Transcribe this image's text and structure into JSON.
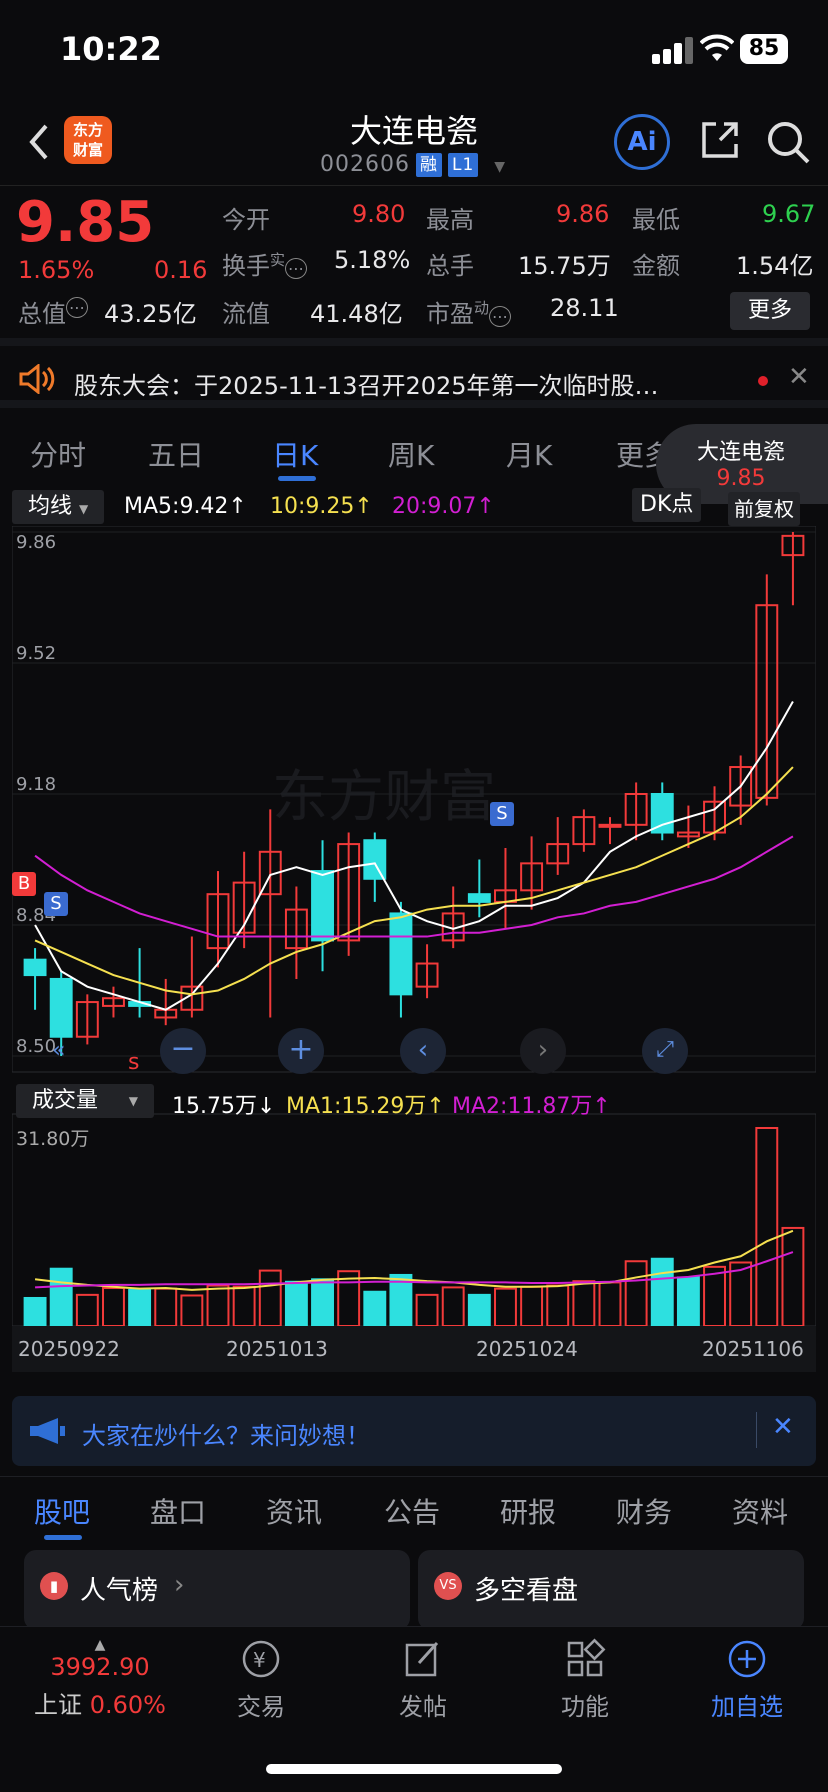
{
  "status_bar": {
    "time": "10:22",
    "battery": "85"
  },
  "header": {
    "logo_text": "东方财富",
    "title": "大连电瓷",
    "code": "002606",
    "tag1": "融",
    "tag2": "L1"
  },
  "quote": {
    "price": "9.85",
    "change_pct": "1.65%",
    "change": "0.16",
    "open_label": "今开",
    "open": "9.80",
    "high_label": "最高",
    "high": "9.86",
    "low_label": "最低",
    "low": "9.67",
    "turnover_label": "换手",
    "turnover_sup": "实",
    "turnover": "5.18%",
    "volume_label": "总手",
    "volume": "15.75万",
    "amount_label": "金额",
    "amount": "1.54亿",
    "mktcap_label": "总值",
    "mktcap": "43.25亿",
    "float_label": "流值",
    "float": "41.48亿",
    "pe_label": "市盈",
    "pe_sup": "动",
    "pe": "28.11",
    "more": "更多"
  },
  "notice": {
    "text": "股东大会：于2025-11-13召开2025年第一次临时股…"
  },
  "tabs": [
    "分时",
    "五日",
    "日K",
    "周K",
    "月K",
    "更多"
  ],
  "chip": {
    "name": "大连电瓷",
    "price": "9.85"
  },
  "kline": {
    "ma_dropdown": "均线",
    "ma5": "MA5:9.42↑",
    "ma10": "10:9.25↑",
    "ma20": "20:9.07↑",
    "dk": "DK点",
    "adj": "前复权",
    "y_labels": [
      "9.86",
      "9.52",
      "9.18",
      "8.84",
      "8.50"
    ],
    "marker_b": "B",
    "marker_s": "S",
    "small_s": "s"
  },
  "volume": {
    "dropdown": "成交量",
    "vol": "15.75万↓",
    "ma1": "MA1:15.29万↑",
    "ma2": "MA2:11.87万↑",
    "max_label": "31.80万",
    "x_labels": [
      "20250922",
      "20251013",
      "20251024",
      "20251106"
    ]
  },
  "banner": {
    "text": "大家在炒什么？来问妙想！"
  },
  "bottom_tabs": [
    "股吧",
    "盘口",
    "资讯",
    "公告",
    "研报",
    "财务",
    "资料"
  ],
  "cards": {
    "left": "人气榜",
    "right": "多空看盘"
  },
  "footer": {
    "index_value": "3992.90",
    "index_name": "上证",
    "index_change": "0.60%",
    "items": [
      "交易",
      "发帖",
      "功能",
      "加自选"
    ]
  },
  "colors": {
    "up": "#f23a3a",
    "down": "#2de0e0",
    "ma5": "#ffffff",
    "ma10": "#f5e050",
    "ma20": "#d21fd2",
    "accent": "#2f6fd6"
  },
  "chart_data": {
    "type": "candlestick",
    "ylim": [
      8.5,
      9.86
    ],
    "candles": [
      {
        "o": 8.75,
        "c": 8.71,
        "h": 8.78,
        "l": 8.62
      },
      {
        "o": 8.7,
        "c": 8.55,
        "h": 8.72,
        "l": 8.5
      },
      {
        "o": 8.55,
        "c": 8.64,
        "h": 8.66,
        "l": 8.53
      },
      {
        "o": 8.63,
        "c": 8.65,
        "h": 8.68,
        "l": 8.6
      },
      {
        "o": 8.64,
        "c": 8.63,
        "h": 8.78,
        "l": 8.6
      },
      {
        "o": 8.6,
        "c": 8.62,
        "h": 8.7,
        "l": 8.58
      },
      {
        "o": 8.62,
        "c": 8.68,
        "h": 8.81,
        "l": 8.6
      },
      {
        "o": 8.78,
        "c": 8.92,
        "h": 8.98,
        "l": 8.73
      },
      {
        "o": 8.82,
        "c": 8.95,
        "h": 9.03,
        "l": 8.78
      },
      {
        "o": 8.92,
        "c": 9.03,
        "h": 9.14,
        "l": 8.6
      },
      {
        "o": 8.78,
        "c": 8.88,
        "h": 8.94,
        "l": 8.7
      },
      {
        "o": 8.98,
        "c": 8.8,
        "h": 9.06,
        "l": 8.72
      },
      {
        "o": 8.8,
        "c": 9.05,
        "h": 9.08,
        "l": 8.76
      },
      {
        "o": 9.06,
        "c": 8.96,
        "h": 9.08,
        "l": 8.9
      },
      {
        "o": 8.87,
        "c": 8.66,
        "h": 8.9,
        "l": 8.6
      },
      {
        "o": 8.68,
        "c": 8.74,
        "h": 8.79,
        "l": 8.65
      },
      {
        "o": 8.8,
        "c": 8.87,
        "h": 8.94,
        "l": 8.78
      },
      {
        "o": 8.92,
        "c": 8.9,
        "h": 9.01,
        "l": 8.86
      },
      {
        "o": 8.9,
        "c": 8.93,
        "h": 9.04,
        "l": 8.83
      },
      {
        "o": 8.93,
        "c": 9.0,
        "h": 9.07,
        "l": 8.88
      },
      {
        "o": 9.0,
        "c": 9.05,
        "h": 9.12,
        "l": 8.97
      },
      {
        "o": 9.05,
        "c": 9.12,
        "h": 9.14,
        "l": 9.03
      },
      {
        "o": 9.1,
        "c": 9.1,
        "h": 9.12,
        "l": 9.05
      },
      {
        "o": 9.1,
        "c": 9.18,
        "h": 9.21,
        "l": 9.06
      },
      {
        "o": 9.18,
        "c": 9.08,
        "h": 9.21,
        "l": 9.06
      },
      {
        "o": 9.07,
        "c": 9.08,
        "h": 9.15,
        "l": 9.04
      },
      {
        "o": 9.08,
        "c": 9.16,
        "h": 9.2,
        "l": 9.06
      },
      {
        "o": 9.15,
        "c": 9.25,
        "h": 9.28,
        "l": 9.1
      },
      {
        "o": 9.17,
        "c": 9.67,
        "h": 9.75,
        "l": 9.15
      },
      {
        "o": 9.8,
        "c": 9.85,
        "h": 9.86,
        "l": 9.67
      }
    ],
    "ma5": [
      8.84,
      8.72,
      8.68,
      8.66,
      8.64,
      8.62,
      8.66,
      8.74,
      8.84,
      8.97,
      8.99,
      8.97,
      8.99,
      9.0,
      8.88,
      8.85,
      8.83,
      8.85,
      8.89,
      8.89,
      8.91,
      8.95,
      9.03,
      9.07,
      9.1,
      9.12,
      9.14,
      9.2,
      9.3,
      9.42
    ],
    "ma10": [
      8.8,
      8.77,
      8.74,
      8.71,
      8.69,
      8.67,
      8.66,
      8.67,
      8.7,
      8.74,
      8.77,
      8.79,
      8.82,
      8.85,
      8.86,
      8.88,
      8.89,
      8.89,
      8.9,
      8.91,
      8.93,
      8.95,
      8.97,
      8.99,
      9.02,
      9.05,
      9.08,
      9.12,
      9.18,
      9.25
    ],
    "ma20": [
      9.02,
      8.97,
      8.93,
      8.9,
      8.87,
      8.85,
      8.83,
      8.81,
      8.81,
      8.81,
      8.81,
      8.81,
      8.81,
      8.81,
      8.81,
      8.81,
      8.82,
      8.82,
      8.83,
      8.84,
      8.86,
      8.87,
      8.89,
      8.9,
      8.92,
      8.94,
      8.96,
      8.99,
      9.03,
      9.07
    ],
    "volume_ylim": [
      0,
      31.8
    ],
    "volumes": [
      4.5,
      9.2,
      5.0,
      6.1,
      5.8,
      6.0,
      4.9,
      6.5,
      6.3,
      8.9,
      7.1,
      7.5,
      8.8,
      5.5,
      8.2,
      5.0,
      6.2,
      5.0,
      6.0,
      6.3,
      6.5,
      7.2,
      7.0,
      10.4,
      10.8,
      7.8,
      9.5,
      10.2,
      31.8,
      15.75
    ],
    "vol_up": [
      false,
      false,
      true,
      true,
      false,
      true,
      true,
      true,
      true,
      true,
      false,
      false,
      true,
      false,
      false,
      true,
      true,
      false,
      true,
      true,
      true,
      true,
      true,
      true,
      false,
      false,
      true,
      true,
      true,
      true
    ],
    "vol_ma1": [
      7.5,
      7.0,
      6.6,
      6.3,
      6.0,
      6.1,
      5.8,
      6.0,
      6.1,
      6.5,
      7.0,
      7.4,
      7.6,
      7.7,
      7.5,
      7.2,
      7.0,
      6.6,
      6.3,
      6.3,
      6.4,
      6.8,
      7.0,
      7.8,
      8.5,
      9.0,
      10.2,
      11.2,
      13.6,
      15.29
    ],
    "vol_ma2": [
      6.2,
      6.4,
      6.5,
      6.6,
      6.6,
      6.7,
      6.7,
      6.7,
      6.7,
      6.8,
      6.9,
      7.0,
      7.0,
      7.1,
      7.1,
      7.0,
      7.0,
      7.0,
      7.0,
      6.9,
      6.9,
      7.0,
      7.1,
      7.3,
      7.6,
      7.9,
      8.4,
      9.0,
      10.4,
      11.87
    ]
  }
}
